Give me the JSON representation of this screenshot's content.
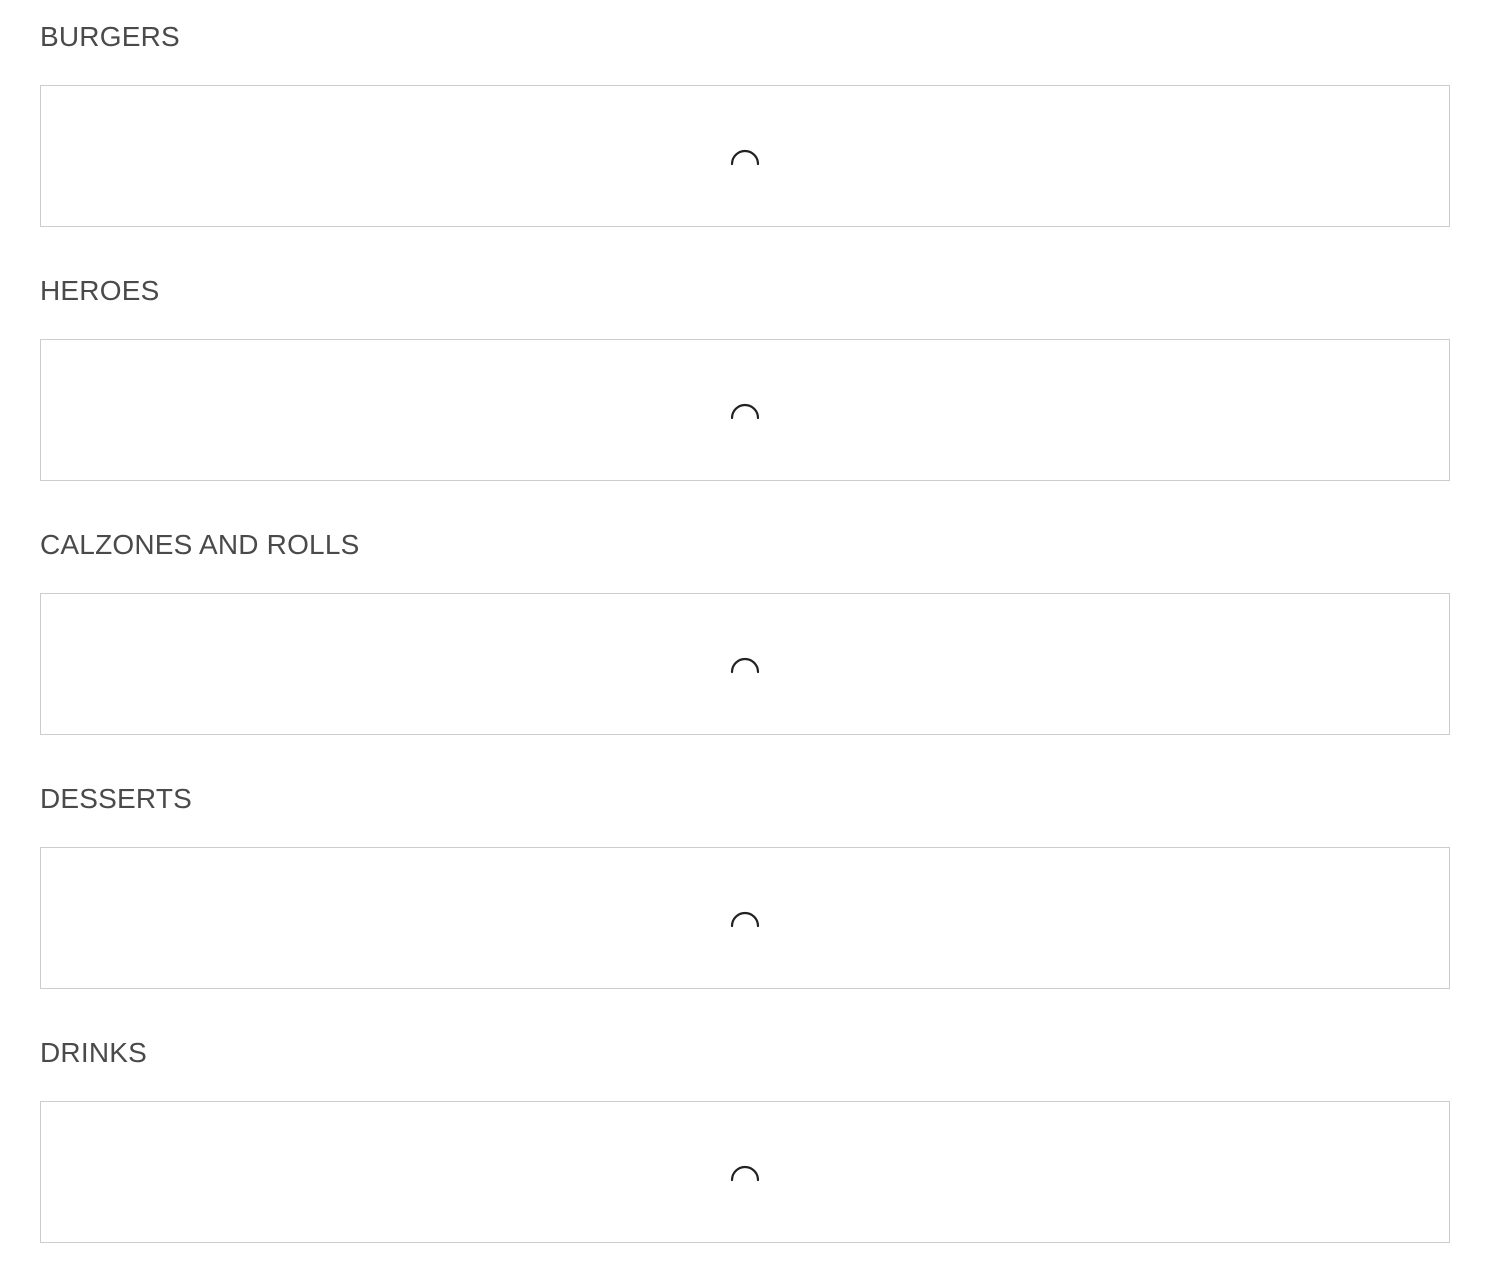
{
  "menu": {
    "sections": [
      {
        "title": "BURGERS",
        "status": "loading"
      },
      {
        "title": "HEROES",
        "status": "loading"
      },
      {
        "title": "CALZONES AND ROLLS",
        "status": "loading"
      },
      {
        "title": "DESSERTS",
        "status": "loading"
      },
      {
        "title": "DRINKS",
        "status": "loading"
      }
    ]
  },
  "icons": {
    "spinner": "loading-spinner-icon"
  },
  "colors": {
    "heading": "#4a4a4a",
    "border": "#cccccc",
    "spinner": "#222222",
    "background": "#ffffff"
  }
}
